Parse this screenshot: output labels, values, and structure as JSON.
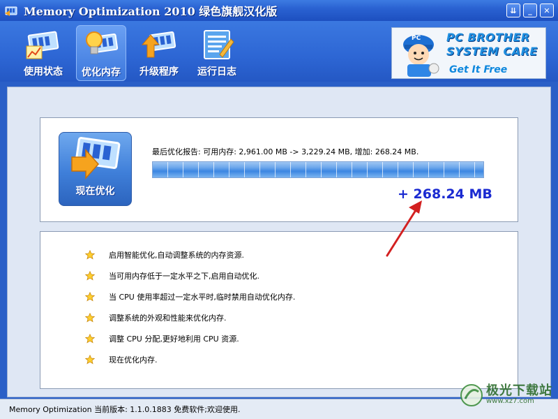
{
  "window": {
    "title": "Memory Optimization 2010 绿色旗舰汉化版",
    "menu_glyph": "⇊",
    "minimize_glyph": "_",
    "close_glyph": "✕"
  },
  "toolbar": {
    "items": [
      {
        "label": "使用状态",
        "icon": "chart-memory-icon",
        "active": false
      },
      {
        "label": "优化内存",
        "icon": "bulb-memory-icon",
        "active": true
      },
      {
        "label": "升级程序",
        "icon": "upgrade-memory-icon",
        "active": false
      },
      {
        "label": "运行日志",
        "icon": "log-notepad-icon",
        "active": false
      }
    ]
  },
  "banner": {
    "line1": "PC BROTHER",
    "line2": "SYSTEM CARE",
    "line3": "Get It Free",
    "cap_text": "PC"
  },
  "optimize": {
    "button_label": "现在优化",
    "report": "最后优化报告: 可用内存: 2,961.00 MB -> 3,229.24 MB, 增加: 268.24 MB.",
    "progress_percent": 100,
    "gain": "+ 268.24 MB"
  },
  "features": [
    "启用智能优化,自动调整系统的内存资源.",
    "当可用内存低于一定水平之下,启用自动优化.",
    "当 CPU 使用率超过一定水平时,临时禁用自动优化内存.",
    "调整系统的外观和性能来优化内存.",
    "调整 CPU 分配,更好地利用 CPU 资源.",
    "现在优化内存."
  ],
  "status": {
    "text": "Memory Optimization 当前版本: 1.1.0.1883 免费软件;欢迎使用."
  },
  "watermark": {
    "line1": "极光下载站",
    "line2": "www.xz7.com"
  },
  "colors": {
    "accent": "#2a62d2",
    "gain_text": "#1a2ad1",
    "arrow": "#d32020"
  }
}
